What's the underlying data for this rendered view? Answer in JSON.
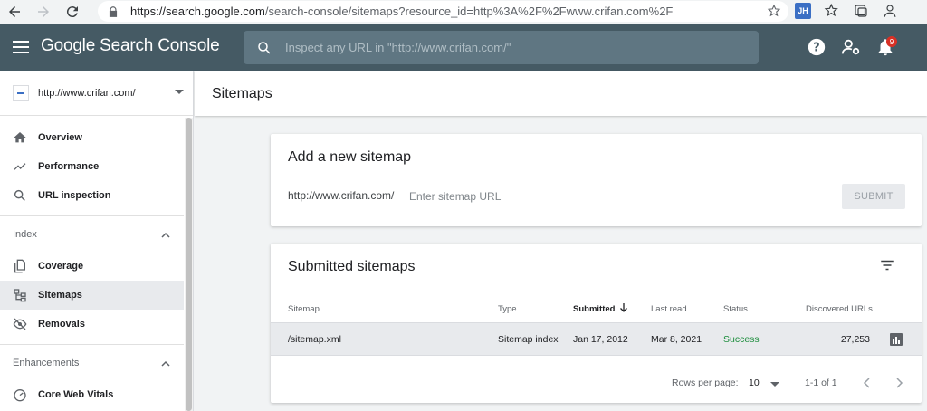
{
  "browser": {
    "url_host": "https://search.google.com",
    "url_rest": "/search-console/sitemaps?resource_id=http%3A%2F%2Fwww.crifan.com%2F",
    "extension_badge": "JH"
  },
  "header": {
    "app_name": "Google Search Console",
    "search_placeholder": "Inspect any URL in \"http://www.crifan.com/\"",
    "notification_count": "9"
  },
  "sidebar": {
    "property": "http://www.crifan.com/",
    "items": [
      {
        "label": "Overview",
        "icon": "home-icon"
      },
      {
        "label": "Performance",
        "icon": "trending-up-icon"
      },
      {
        "label": "URL inspection",
        "icon": "search-icon"
      }
    ],
    "sections": [
      {
        "label": "Index",
        "items": [
          {
            "label": "Coverage",
            "icon": "coverage-icon"
          },
          {
            "label": "Sitemaps",
            "icon": "sitemap-icon"
          },
          {
            "label": "Removals",
            "icon": "eye-off-icon"
          }
        ]
      },
      {
        "label": "Enhancements",
        "items": [
          {
            "label": "Core Web Vitals",
            "icon": "gauge-icon"
          }
        ]
      }
    ]
  },
  "main": {
    "title": "Sitemaps",
    "add_card": {
      "title": "Add a new sitemap",
      "prefix": "http://www.crifan.com/",
      "placeholder": "Enter sitemap URL",
      "submit_label": "SUBMIT"
    },
    "list_card": {
      "title": "Submitted sitemaps",
      "columns": [
        "Sitemap",
        "Type",
        "Submitted",
        "Last read",
        "Status",
        "Discovered URLs"
      ],
      "rows": [
        {
          "sitemap": "/sitemap.xml",
          "type": "Sitemap index",
          "submitted": "Jan 17, 2012",
          "last_read": "Mar 8, 2021",
          "status": "Success",
          "discovered": "27,253"
        }
      ],
      "rows_per_page_label": "Rows per page:",
      "rows_per_page_value": "10",
      "range": "1-1 of 1"
    }
  },
  "colors": {
    "header_bg": "#455a64",
    "success": "#1e8e3e",
    "active_bg": "#e8eaed"
  }
}
